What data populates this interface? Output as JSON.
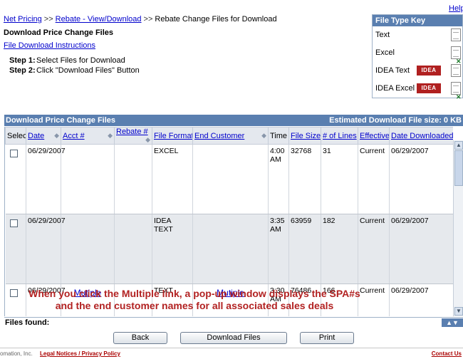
{
  "header": {
    "help_label": "Help",
    "breadcrumb": [
      {
        "label": "Net Pricing",
        "link": true
      },
      {
        "label": "Rebate - View/Download",
        "link": true
      },
      {
        "label": "Rebate Change Files for Download",
        "link": false
      }
    ],
    "breadcrumb_sep": ">>",
    "page_title": "Download Price Change Files",
    "instructions_link": "File Download Instructions",
    "steps": [
      {
        "label": "Step 1:",
        "text": "Select Files for Download"
      },
      {
        "label": "Step 2:",
        "text": "Click \"Download Files\" Button"
      }
    ]
  },
  "file_type_key": {
    "title": "File Type Key",
    "rows": [
      {
        "label": "Text",
        "icon": "text-file-icon"
      },
      {
        "label": "Excel",
        "icon": "excel-file-icon"
      },
      {
        "label": "IDEA Text",
        "badge": "IDEA",
        "icon": "text-file-icon"
      },
      {
        "label": "IDEA Excel",
        "badge": "IDEA",
        "icon": "excel-file-icon"
      }
    ]
  },
  "grid": {
    "title": "Download Price Change Files",
    "estimate": "Estimated Download File size: 0 KB",
    "columns": [
      "Select",
      "Date",
      "Acct #",
      "Rebate #",
      "File Format",
      "End Customer",
      "Time",
      "File Size",
      "# of Lines",
      "Effective",
      "Date Downloaded"
    ],
    "rows": [
      {
        "date": "06/29/2007",
        "acct": "",
        "rebate": "",
        "format": "EXCEL",
        "customer": "",
        "time": "4:00 AM",
        "size": "32768",
        "lines": "31",
        "effective": "Current",
        "downloaded": "06/29/2007"
      },
      {
        "date": "06/29/2007",
        "acct": "",
        "rebate": "",
        "format": "IDEA TEXT",
        "customer": "",
        "time": "3:35 AM",
        "size": "63959",
        "lines": "182",
        "effective": "Current",
        "downloaded": "06/29/2007"
      },
      {
        "date": "06/29/2007",
        "acct": "Mutiple",
        "rebate": "",
        "format": "TEXT",
        "customer": "Mutiple",
        "time": "3:30 AM",
        "size": "76486",
        "lines": "166",
        "effective": "Current",
        "downloaded": "06/29/2007"
      }
    ],
    "files_found": "Files found:"
  },
  "annotation": "When you click the Multiple link, a pop-up window displays the SPA#s and the end customer names for all associated sales deals",
  "buttons": {
    "back": "Back",
    "download": "Download Files",
    "print": "Print"
  },
  "footer": {
    "copyright": "omation, Inc.",
    "legal": "Legal Notices / Privacy Policy",
    "contact": "Contact Us"
  },
  "colors": {
    "header_blue": "#5a7fb0",
    "annotation_red": "#b22222",
    "link": "#0000cc"
  }
}
